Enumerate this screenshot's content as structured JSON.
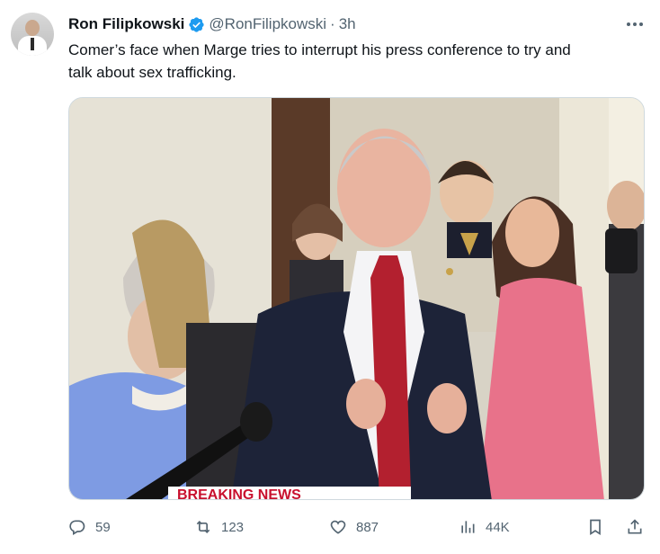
{
  "author": {
    "name": "Ron Filipkowski",
    "handle": "@RonFilipkowski",
    "separator": "·",
    "time": "3h"
  },
  "tweet": {
    "text_line1": "Comer’s face when Marge tries to interrupt his press conference to try and",
    "text_line2": "talk about sex trafficking."
  },
  "media": {
    "lower_third_text": "BREAKING NEWS"
  },
  "actions": {
    "replies": "59",
    "retweets": "123",
    "likes": "887",
    "views": "44K"
  },
  "colors": {
    "verified": "#1d9bf0",
    "secondary_text": "#536471",
    "tie": "#b3202f",
    "dress": "#e8728a"
  },
  "icons": [
    "reply-icon",
    "retweet-icon",
    "like-icon",
    "views-icon",
    "bookmark-icon",
    "share-icon",
    "more-icon",
    "verified-badge-icon"
  ]
}
